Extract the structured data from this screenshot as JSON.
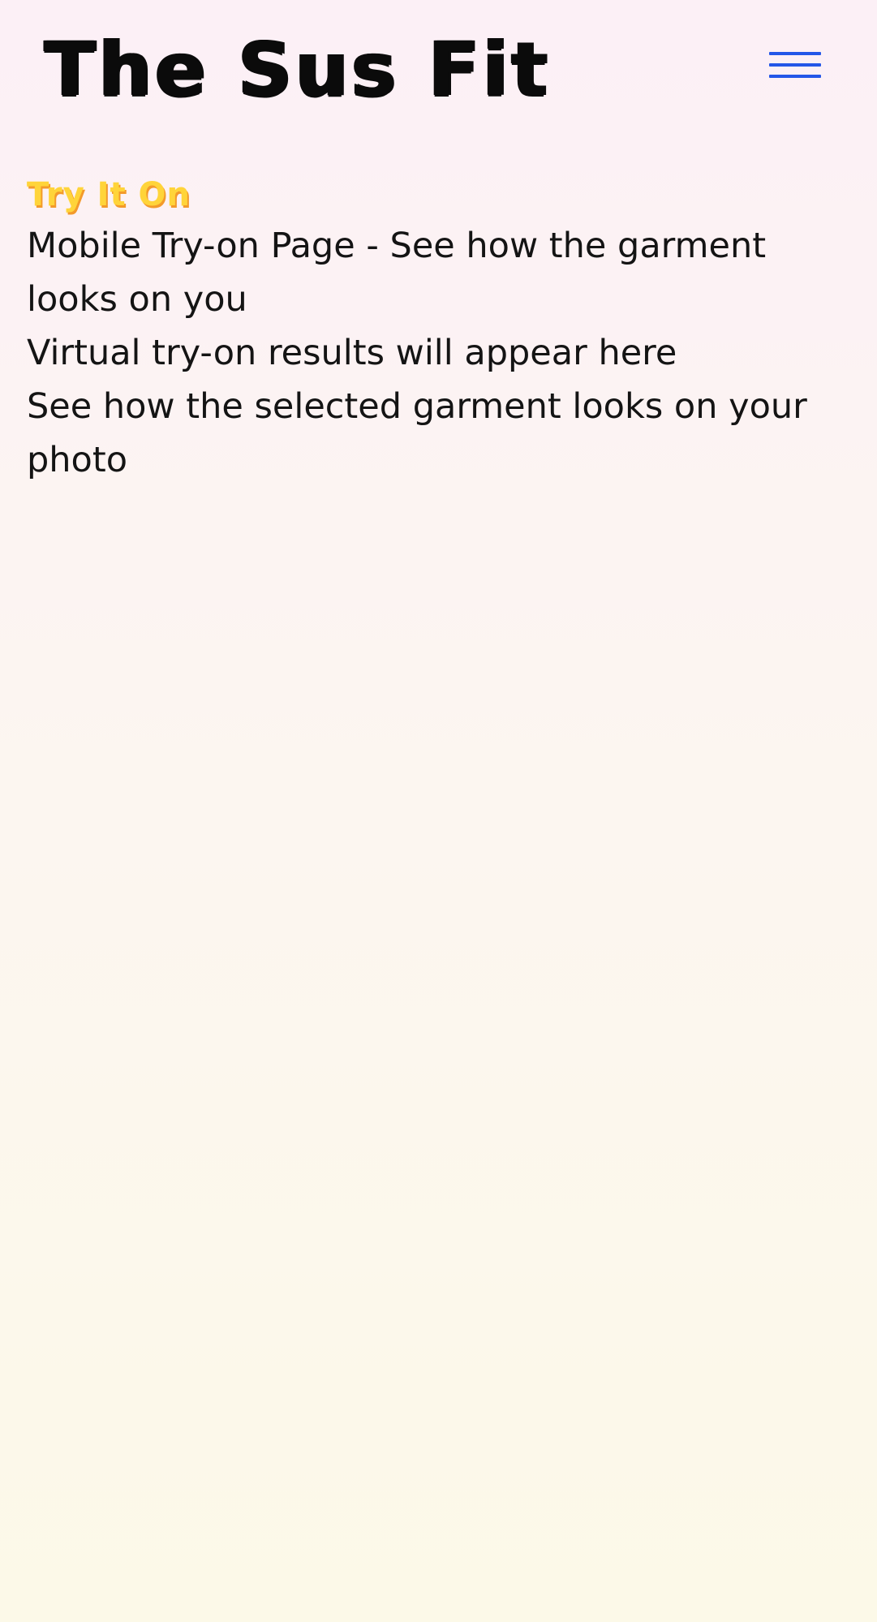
{
  "header": {
    "logo_text": "The Sus Fit",
    "menu_icon": "hamburger-menu-icon",
    "menu_color": "#2457e8"
  },
  "main": {
    "heading": "Try It On",
    "description": "Mobile Try-on Page - See how the garment looks on you",
    "results_placeholder": "Virtual try-on results will appear here",
    "results_subtext": "See how the selected garment looks on your photo"
  },
  "colors": {
    "heading": "#ffd43a",
    "heading_shadow": "#f39a2a",
    "text": "#141414"
  }
}
